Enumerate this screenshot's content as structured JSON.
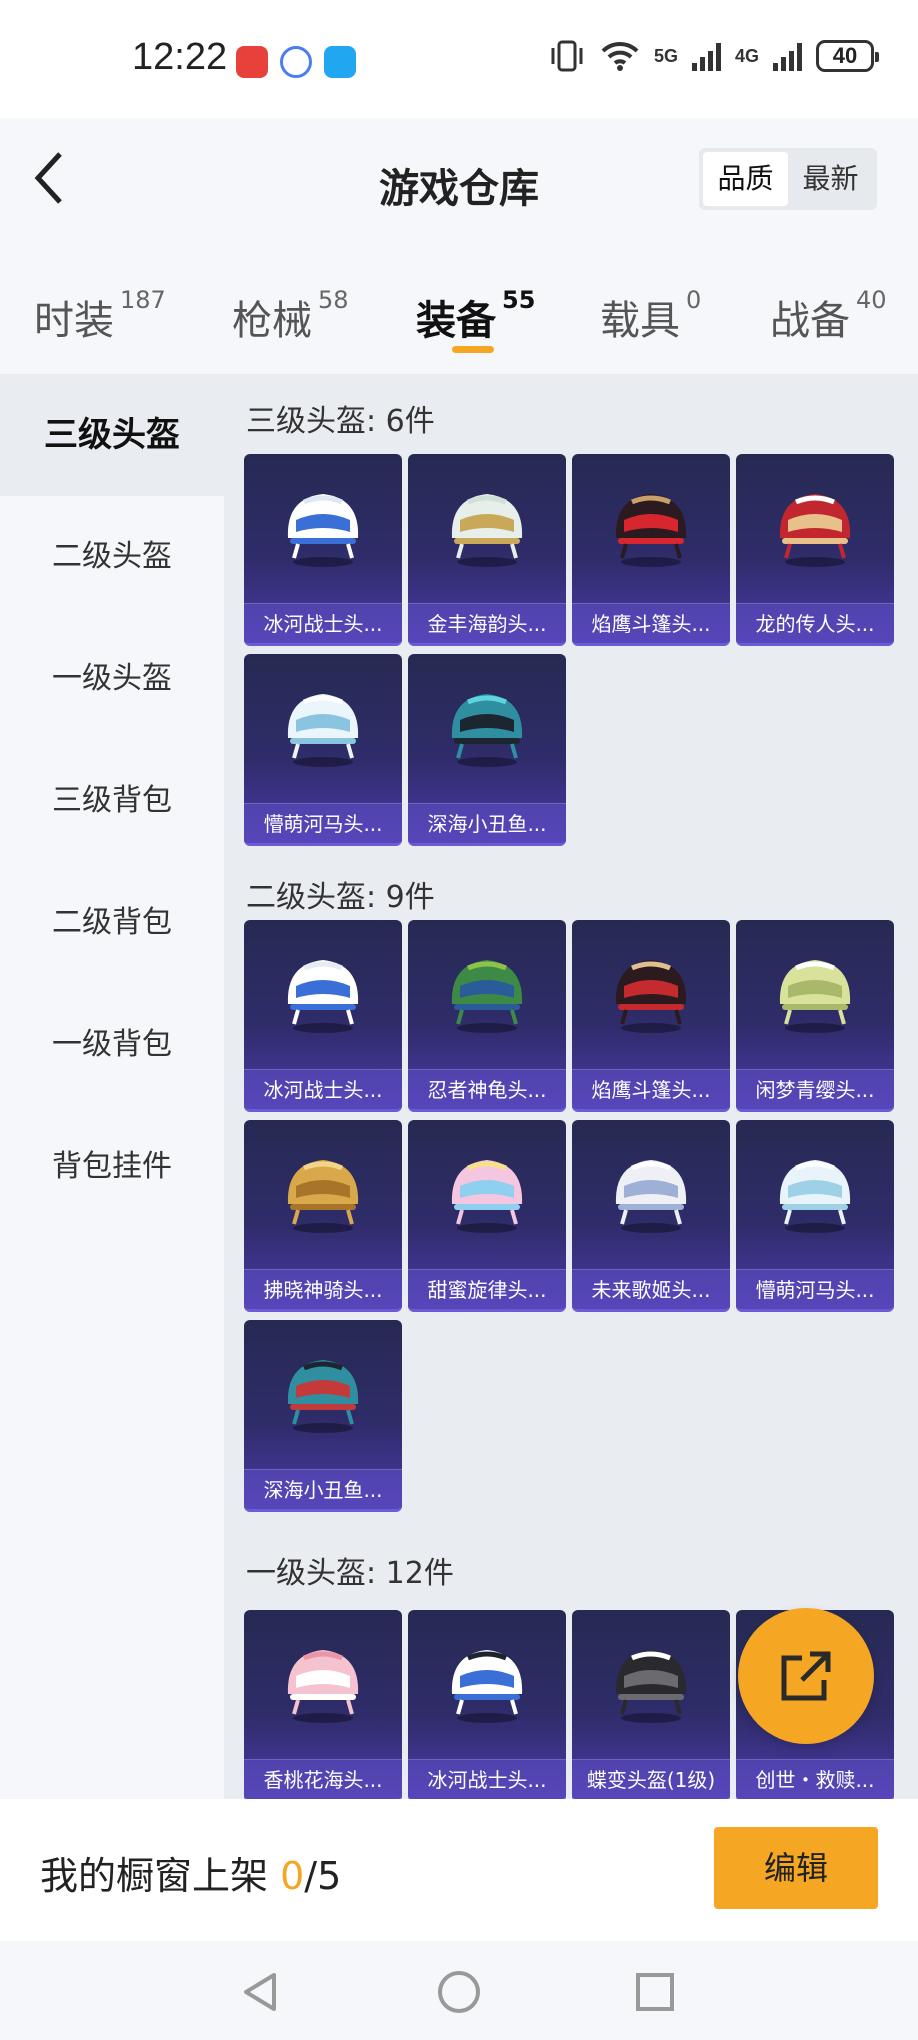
{
  "status": {
    "time": "12:22",
    "battery": "40",
    "sig1": "5G",
    "sig2": "4G"
  },
  "header": {
    "title": "游戏仓库",
    "sort_options": [
      "品质",
      "最新"
    ]
  },
  "tabs": [
    {
      "label": "时装",
      "count": "187"
    },
    {
      "label": "枪械",
      "count": "58"
    },
    {
      "label": "装备",
      "count": "55"
    },
    {
      "label": "载具",
      "count": "0"
    },
    {
      "label": "战备",
      "count": "40"
    }
  ],
  "sidebar": {
    "items": [
      "三级头盔",
      "二级头盔",
      "一级头盔",
      "三级背包",
      "二级背包",
      "一级背包",
      "背包挂件"
    ]
  },
  "sections": [
    {
      "title": "三级头盔: 6件",
      "items": [
        "冰河战士头...",
        "金丰海韵头...",
        "焰鹰斗篷头...",
        "龙的传人头...",
        "懵萌河马头...",
        "深海小丑鱼..."
      ]
    },
    {
      "title": "二级头盔: 9件",
      "items": [
        "冰河战士头...",
        "忍者神龟头...",
        "焰鹰斗篷头...",
        "闲梦青缨头...",
        "拂晓神骑头...",
        "甜蜜旋律头...",
        "未来歌姬头...",
        "懵萌河马头...",
        "深海小丑鱼..."
      ]
    },
    {
      "title": "一级头盔: 12件",
      "items": [
        "香桃花海头...",
        "冰河战士头...",
        "蝶变头盔(1级)",
        "创世・救赎..."
      ]
    }
  ],
  "bottom": {
    "shelf_label": "我的橱窗上架 ",
    "shelf_current": "0",
    "shelf_total": "/5",
    "edit_label": "编辑"
  },
  "colors": {
    "accent": "#f5a623",
    "card_top": "#262a52",
    "card_bottom": "#4a3aa8"
  }
}
